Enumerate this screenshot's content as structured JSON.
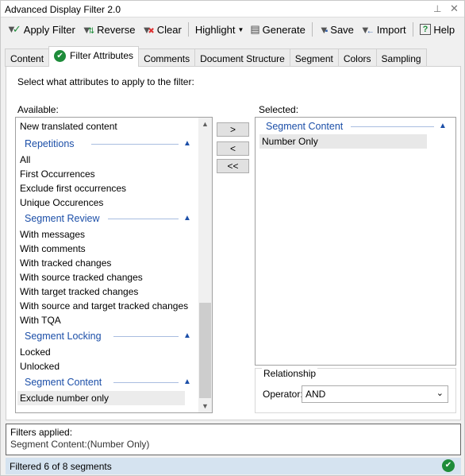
{
  "window": {
    "title": "Advanced Display Filter 2.0",
    "pin_icon": "pin-icon",
    "close_icon": "close-icon"
  },
  "toolbar": {
    "apply": "Apply Filter",
    "reverse": "Reverse",
    "clear": "Clear",
    "highlight": "Highlight",
    "generate": "Generate",
    "save": "Save",
    "import": "Import",
    "help": "Help"
  },
  "tabs": [
    "Content",
    "Filter Attributes",
    "Comments",
    "Document Structure",
    "Segment",
    "Colors",
    "Sampling"
  ],
  "active_tab": "Filter Attributes",
  "panel": {
    "instruction": "Select what attributes to apply to the filter:",
    "available_label": "Available:",
    "selected_label": "Selected:"
  },
  "available": {
    "top_item": "New translated content",
    "groups": [
      {
        "name": "Repetitions",
        "items": [
          "All",
          "First Occurrences",
          "Exclude first occurrences",
          "Unique Occurences"
        ]
      },
      {
        "name": "Segment Review",
        "items": [
          "With messages",
          "With comments",
          "With tracked changes",
          "With source tracked changes",
          "With target tracked changes",
          "With source and target tracked changes",
          "With TQA"
        ]
      },
      {
        "name": "Segment Locking",
        "items": [
          "Locked",
          "Unlocked"
        ]
      },
      {
        "name": "Segment Content",
        "items": [
          "Exclude number only"
        ]
      }
    ]
  },
  "buttons": {
    "add": ">",
    "remove": "<",
    "remove_all": "<<"
  },
  "selected": {
    "group": "Segment Content",
    "items": [
      "Number Only"
    ]
  },
  "relationship": {
    "legend": "Relationship",
    "operator_label": "Operator:",
    "operator_value": "AND"
  },
  "filters_applied": {
    "title": "Filters applied:",
    "value": "Segment Content:(Number Only)"
  },
  "status": {
    "text": "Filtered 6 of 8 segments",
    "color": "#d5e3f0"
  },
  "colors": {
    "accent": "#1c4fa8",
    "check": "#1e8c3a"
  }
}
